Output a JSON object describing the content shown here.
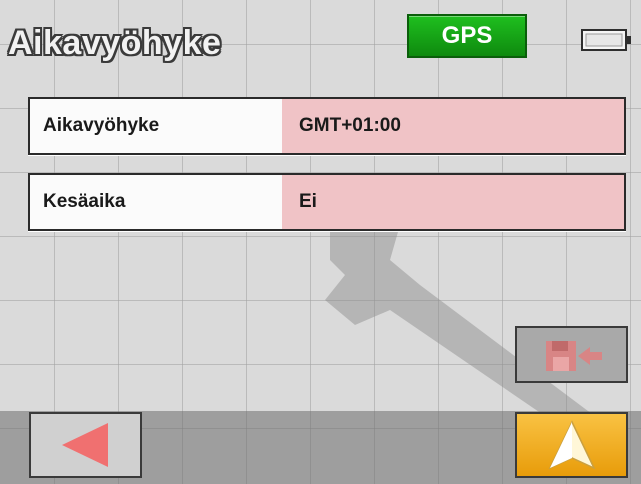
{
  "header": {
    "title": "Aikavyöhyke",
    "gps_label": "GPS"
  },
  "settings": {
    "rows": [
      {
        "label": "Aikavyöhyke",
        "value": "GMT+01:00"
      },
      {
        "label": "Kesäaika",
        "value": "Ei"
      }
    ]
  },
  "buttons": {
    "save_icon": "save-to-memory-icon",
    "back_icon": "back-arrow-icon",
    "navigate_icon": "navigation-arrow-icon"
  },
  "colors": {
    "gps": "#1aa51a",
    "value_bg": "#f0c3c6",
    "navigate_bg": "#f2ae22",
    "back_arrow": "#f07070"
  }
}
